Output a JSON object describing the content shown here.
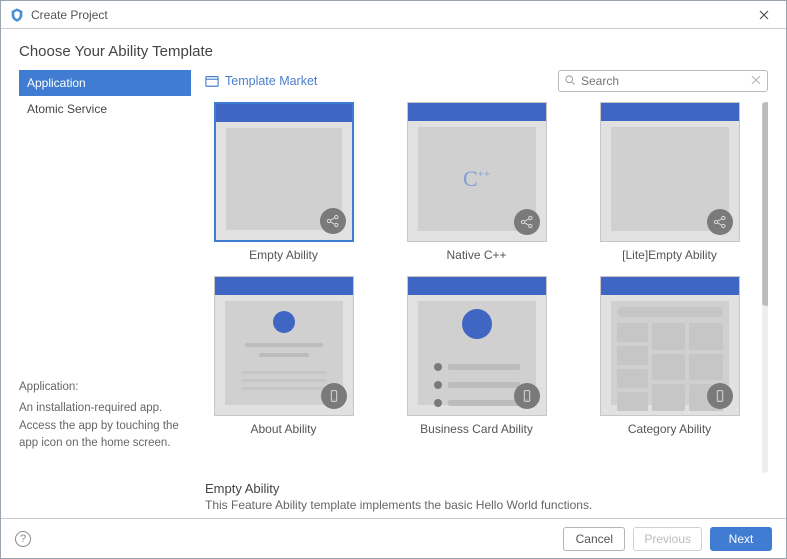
{
  "title": "Create Project",
  "heading": "Choose Your Ability Template",
  "sidebar": {
    "items": [
      {
        "label": "Application",
        "selected": true
      },
      {
        "label": "Atomic Service",
        "selected": false
      }
    ],
    "info_title": "Application:",
    "info_body": "An installation-required app. Access the app by touching the app icon on the home screen."
  },
  "toolbar": {
    "market_label": "Template Market",
    "search_placeholder": "Search"
  },
  "templates": [
    {
      "label": "Empty Ability",
      "selected": true,
      "badge": "share",
      "content": "plain"
    },
    {
      "label": "Native C++",
      "selected": false,
      "badge": "share",
      "content": "cpp"
    },
    {
      "label": "[Lite]Empty Ability",
      "selected": false,
      "badge": "share",
      "content": "plain"
    },
    {
      "label": "About Ability",
      "selected": false,
      "badge": "phone",
      "content": "about"
    },
    {
      "label": "Business Card Ability",
      "selected": false,
      "badge": "phone",
      "content": "bizcard"
    },
    {
      "label": "Category Ability",
      "selected": false,
      "badge": "phone",
      "content": "category"
    }
  ],
  "selected_template": {
    "name": "Empty Ability",
    "description": "This Feature Ability template implements the basic Hello World functions."
  },
  "footer": {
    "cancel": "Cancel",
    "previous": "Previous",
    "next": "Next"
  }
}
